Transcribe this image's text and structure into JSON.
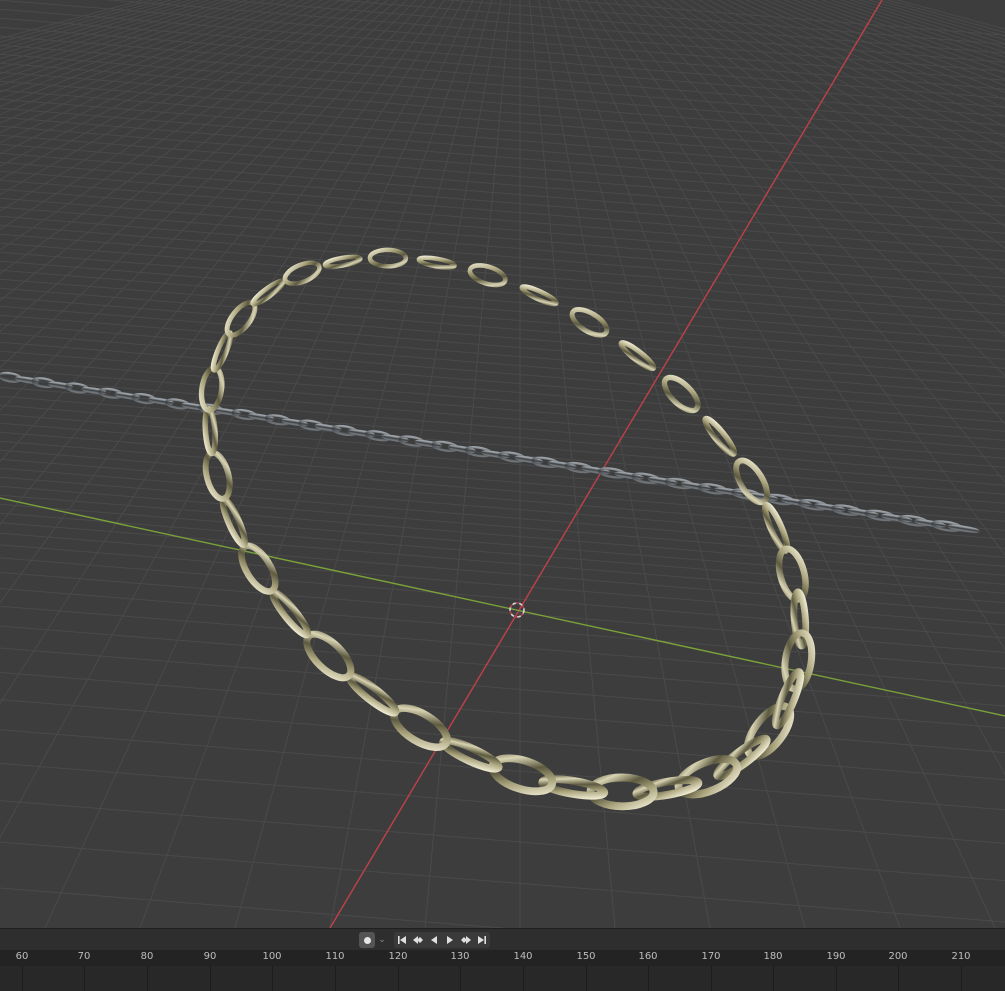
{
  "viewport": {
    "grid_color": "#4a4a4a",
    "background_color": "#3d3d3d",
    "x_axis_color": "#c0404a",
    "y_axis_color": "#7aa23a",
    "origin_marker": "3d-cursor-icon",
    "objects": [
      {
        "name": "chain-loop",
        "material": "gold-metal",
        "color": "#b6b08c"
      },
      {
        "name": "chain-straight",
        "material": "dark-steel",
        "color": "#5c6166"
      }
    ]
  },
  "timeline": {
    "keyframe_toggle_icon": "record-dot-icon",
    "dropdown_icon": "chevron-down-icon",
    "dropdown_glyph": "⌄",
    "transport_icons": [
      "jump-to-start-icon",
      "jump-to-prev-keyframe-icon",
      "play-reverse-icon",
      "play-icon",
      "jump-to-next-keyframe-icon",
      "jump-to-end-icon"
    ],
    "frame_labels": [
      "60",
      "70",
      "80",
      "90",
      "100",
      "110",
      "120",
      "130",
      "140",
      "150",
      "160",
      "170",
      "180",
      "190",
      "200",
      "210"
    ]
  }
}
